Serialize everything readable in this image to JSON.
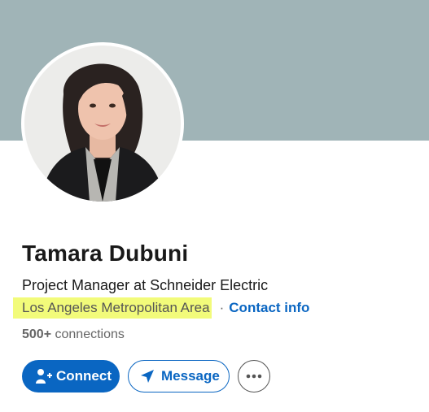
{
  "profile": {
    "name": "Tamara Dubuni",
    "headline": "Project Manager at Schneider Electric",
    "location": "Los Angeles Metropolitan Area",
    "separator": "·",
    "contact_info_label": "Contact info",
    "connections_count": "500+",
    "connections_label": "connections"
  },
  "actions": {
    "connect_label": "Connect",
    "message_label": "Message",
    "more_icon": "more-horizontal-icon",
    "connect_icon": "add-person-icon",
    "message_icon": "send-icon"
  },
  "colors": {
    "cover": "#a0b4b7",
    "accent": "#0a66c2",
    "highlight": "#f2fb7a"
  }
}
